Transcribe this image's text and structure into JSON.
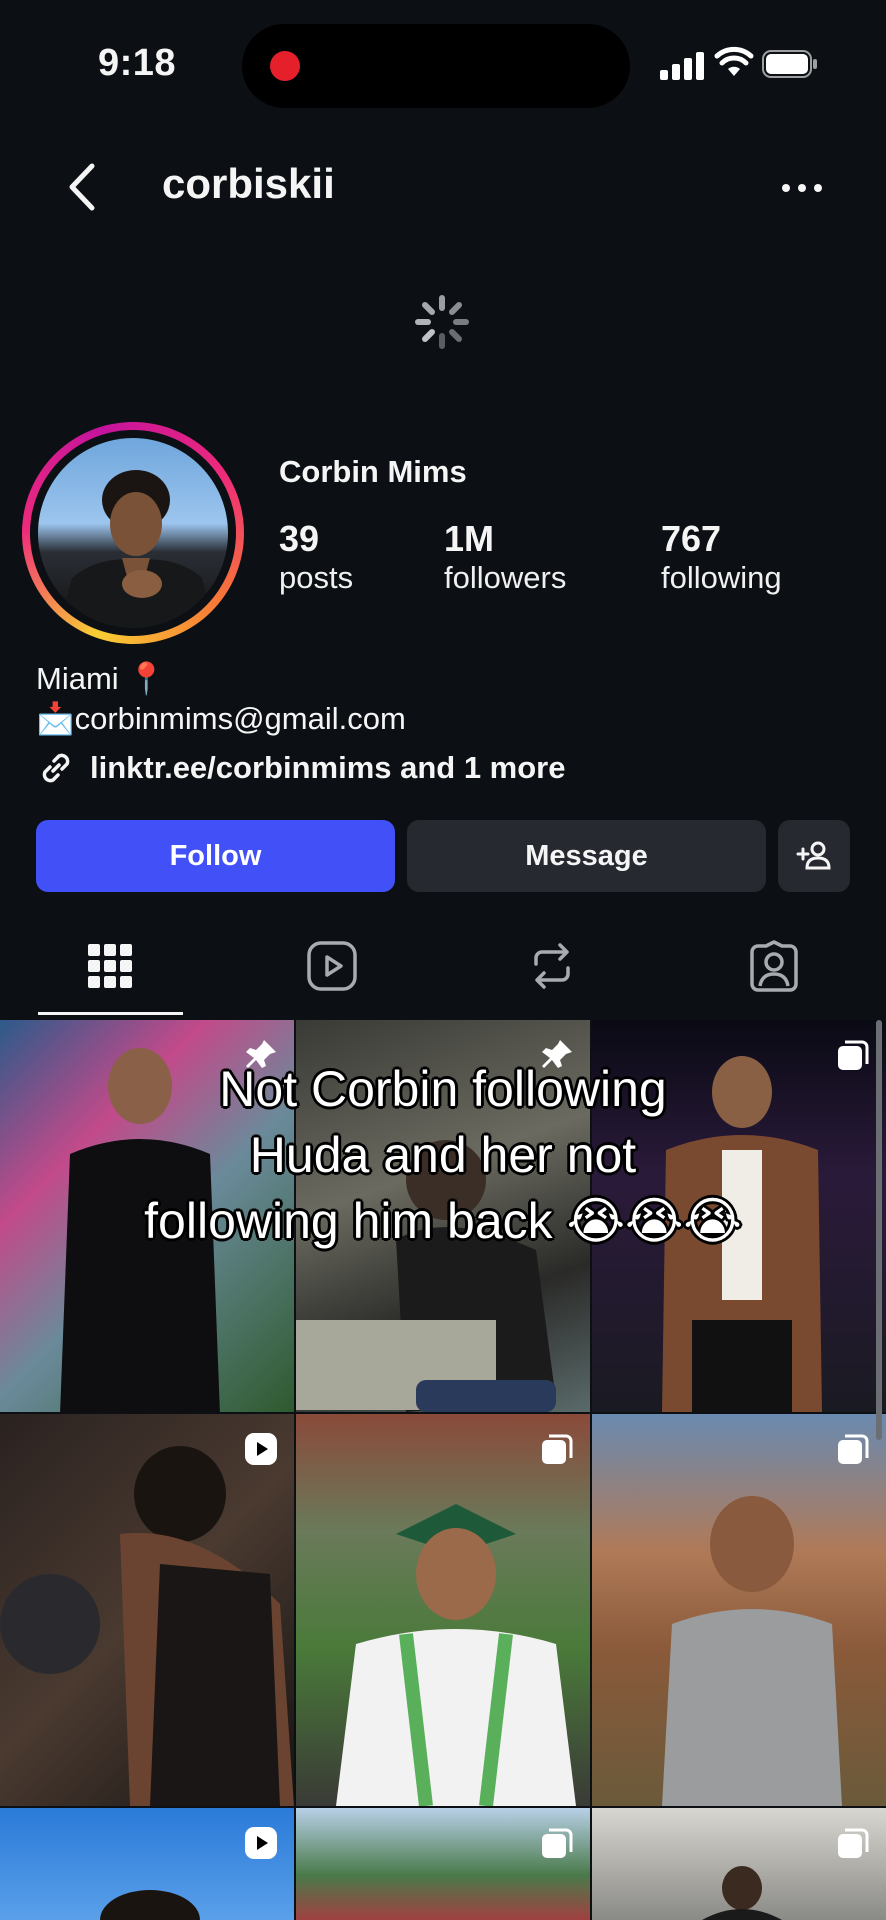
{
  "status_bar": {
    "time": "9:18"
  },
  "header": {
    "username": "corbiskii"
  },
  "profile": {
    "full_name": "Corbin Mims",
    "stats": [
      {
        "value": "39",
        "label": "posts"
      },
      {
        "value": "1M",
        "label": "followers"
      },
      {
        "value": "767",
        "label": "following"
      }
    ],
    "bio_line1": "Miami 📍",
    "bio_line2": "📩corbinmims@gmail.com",
    "link": "linktr.ee/corbinmims and 1 more"
  },
  "actions": {
    "follow_label": "Follow",
    "message_label": "Message"
  },
  "tabs": [
    "grid-icon",
    "reels-icon",
    "reposts-icon",
    "tagged-icon"
  ],
  "overlay_caption": {
    "line1": "Not Corbin following",
    "line2": "Huda and her not",
    "line3": "following him back 😭😭😭"
  },
  "grid": [
    {
      "badge": "pin-icon"
    },
    {
      "badge": "pin-icon"
    },
    {
      "badge": "carousel-icon"
    },
    {
      "badge": "reel-icon"
    },
    {
      "badge": "carousel-icon"
    },
    {
      "badge": "carousel-icon"
    },
    {
      "badge": "reel-icon"
    },
    {
      "badge": "carousel-icon"
    },
    {
      "badge": "carousel-icon"
    }
  ],
  "colors": {
    "background": "#0c1014",
    "follow_button": "#4150f7",
    "secondary_button": "#262a30"
  }
}
